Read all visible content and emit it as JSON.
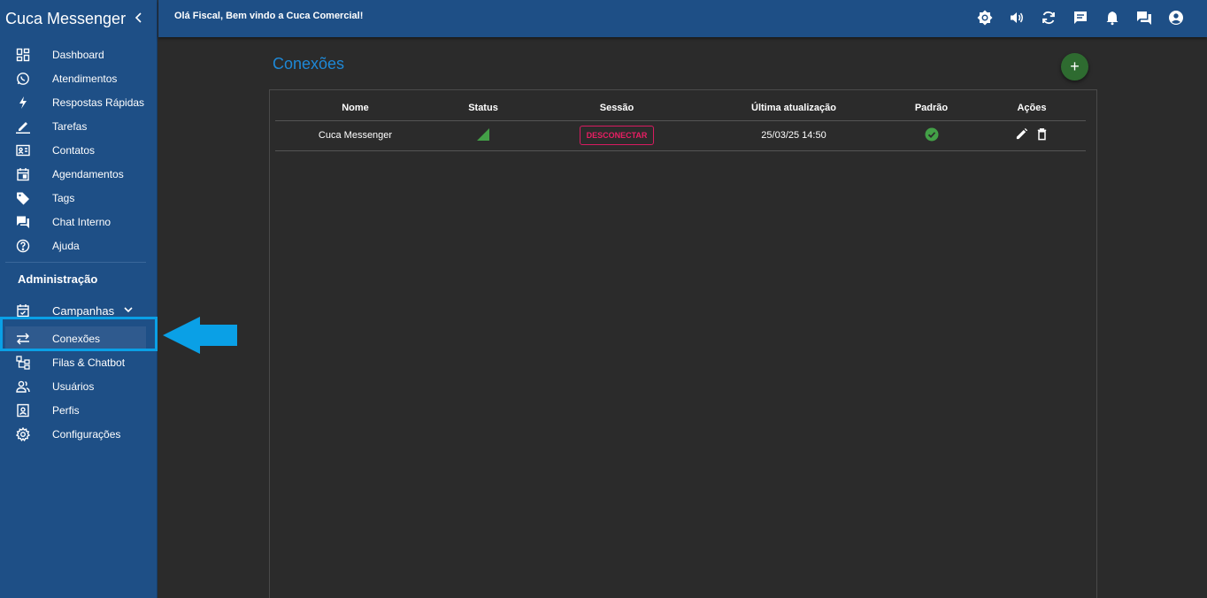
{
  "sidebar": {
    "brand": "Cuca Messenger",
    "items": [
      {
        "label": "Dashboard",
        "icon": "dashboard-icon"
      },
      {
        "label": "Atendimentos",
        "icon": "whatsapp-icon"
      },
      {
        "label": "Respostas Rápidas",
        "icon": "lightning-icon"
      },
      {
        "label": "Tarefas",
        "icon": "pencil-icon"
      },
      {
        "label": "Contatos",
        "icon": "contact-card-icon"
      },
      {
        "label": "Agendamentos",
        "icon": "calendar-icon"
      },
      {
        "label": "Tags",
        "icon": "tag-icon"
      },
      {
        "label": "Chat Interno",
        "icon": "chat-icon"
      },
      {
        "label": "Ajuda",
        "icon": "help-icon"
      }
    ],
    "admin_title": "Administração",
    "admin_items": [
      {
        "label": "Campanhas",
        "icon": "event-icon"
      },
      {
        "label": "Conexões",
        "icon": "swap-icon"
      },
      {
        "label": "Filas & Chatbot",
        "icon": "hierarchy-icon"
      },
      {
        "label": "Usuários",
        "icon": "users-icon"
      },
      {
        "label": "Perfis",
        "icon": "profile-badge-icon"
      },
      {
        "label": "Configurações",
        "icon": "settings-icon"
      }
    ]
  },
  "topbar": {
    "welcome": "Olá Fiscal, Bem vindo a Cuca Comercial!"
  },
  "page": {
    "title": "Conexões",
    "add_label": "+"
  },
  "table": {
    "headers": [
      "Nome",
      "Status",
      "Sessão",
      "Última atualização",
      "Padrão",
      "Ações"
    ],
    "rows": [
      {
        "name": "Cuca Messenger",
        "session_button": "DESCONECTAR",
        "updated": "25/03/25 14:50"
      }
    ]
  },
  "colors": {
    "sidebar": "#1e4f86",
    "accent": "#1e88d6",
    "highlight": "#0aa0e6",
    "danger": "#e91e63",
    "success": "#43a047"
  }
}
